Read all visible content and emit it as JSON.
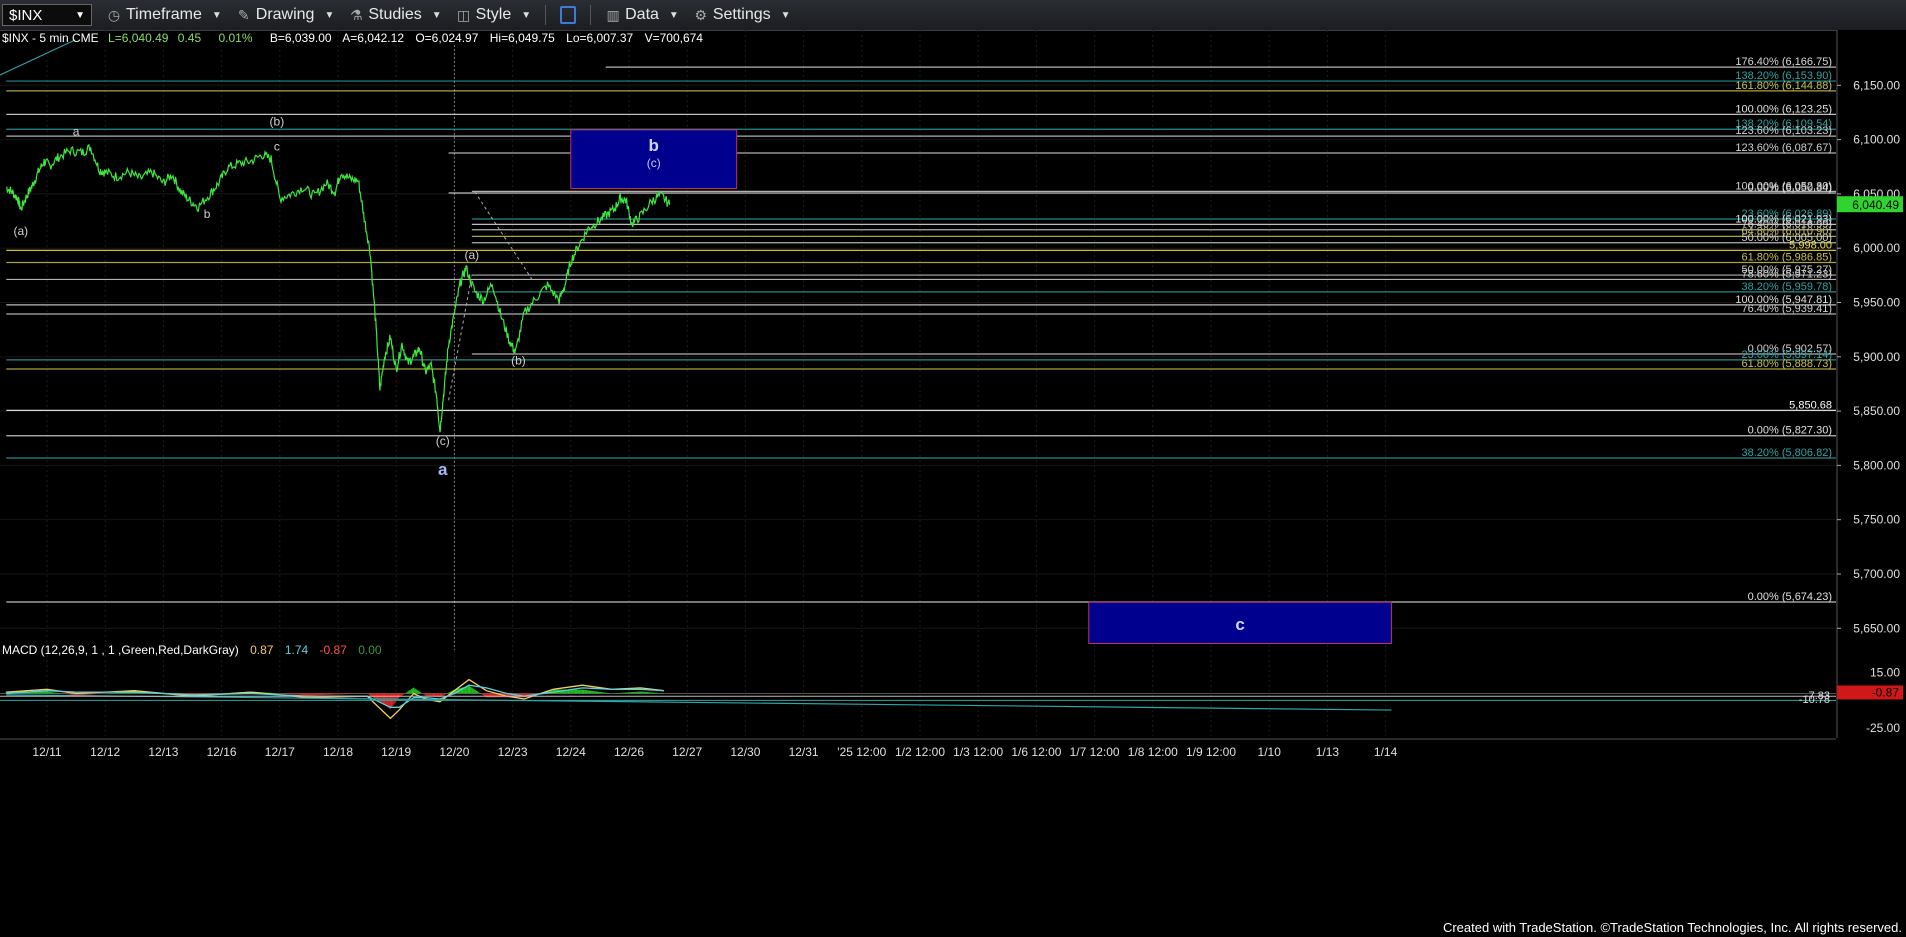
{
  "toolbar": {
    "symbol": "$INX",
    "timeframe": "Timeframe",
    "drawing": "Drawing",
    "studies": "Studies",
    "style": "Style",
    "data": "Data",
    "settings": "Settings"
  },
  "header": {
    "symbol_desc": "$INX - 5 min  CME",
    "last": "L=6,040.49",
    "change": "0.45",
    "pct": "0.01%",
    "bid": "B=6,039.00",
    "ask": "A=6,042.12",
    "open": "O=6,024.97",
    "high": "Hi=6,049.75",
    "low": "Lo=6,007.37",
    "volume": "V=700,674"
  },
  "macd": {
    "label": "MACD (12,26,9, 1 , 1 ,Green,Red,DarkGray)",
    "v1": "0.87",
    "v2": "1.74",
    "v3": "-0.87",
    "v4": "0.00",
    "v1_color": "#f0d060",
    "v2_color": "#5ad0e0",
    "v3_color": "#ff5050",
    "v4_color": "#3c9a3c"
  },
  "footer": "Created with TradeStation. ©TradeStation Technologies, Inc. All rights reserved.",
  "chart_data": {
    "type": "line",
    "y_axis": {
      "ticks": [
        6150,
        6100,
        6050,
        6000,
        5950,
        5900,
        5850,
        5800,
        5750,
        5700,
        5650
      ],
      "tick_labels": [
        "6,150.00",
        "6,100.00",
        "6,050.00",
        "6,000.00",
        "5,950.00",
        "5,900.00",
        "5,850.00",
        "5,800.00",
        "5,750.00",
        "5,700.00",
        "5,650.00"
      ],
      "ylim": [
        5630,
        6200
      ]
    },
    "x_axis": {
      "labels": [
        "12/11",
        "12/12",
        "12/13",
        "12/16",
        "12/17",
        "12/18",
        "12/19",
        "12/20",
        "12/23",
        "12/24",
        "12/26",
        "12/27",
        "12/30",
        "12/31",
        "'25 12:00",
        "1/2 12:00",
        "1/3 12:00",
        "1/6 12:00",
        "1/7 12:00",
        "1/8 12:00",
        "1/9 12:00",
        "1/10",
        "1/13",
        "1/14"
      ],
      "index": [
        0,
        1,
        2,
        3,
        4,
        5,
        6,
        7,
        8,
        9,
        10,
        11,
        12,
        13,
        14,
        15,
        16,
        17,
        18,
        19,
        20,
        21,
        22,
        23
      ]
    },
    "last_price": {
      "value": 6040.49,
      "label": "6,040.49"
    },
    "price_series": [
      [
        -0.7,
        6056
      ],
      [
        -0.6,
        6052
      ],
      [
        -0.5,
        6045
      ],
      [
        -0.45,
        6036
      ],
      [
        -0.35,
        6048
      ],
      [
        -0.25,
        6058
      ],
      [
        -0.15,
        6070
      ],
      [
        -0.05,
        6080
      ],
      [
        0.05,
        6076
      ],
      [
        0.2,
        6084
      ],
      [
        0.4,
        6090
      ],
      [
        0.6,
        6088
      ],
      [
        0.75,
        6093
      ],
      [
        0.9,
        6072
      ],
      [
        1.0,
        6070
      ],
      [
        1.2,
        6066
      ],
      [
        1.4,
        6070
      ],
      [
        1.6,
        6064
      ],
      [
        1.8,
        6070
      ],
      [
        2.0,
        6060
      ],
      [
        2.15,
        6068
      ],
      [
        2.3,
        6052
      ],
      [
        2.45,
        6044
      ],
      [
        2.6,
        6038
      ],
      [
        2.8,
        6050
      ],
      [
        2.95,
        6060
      ],
      [
        3.1,
        6074
      ],
      [
        3.3,
        6078
      ],
      [
        3.5,
        6080
      ],
      [
        3.7,
        6086
      ],
      [
        3.85,
        6082
      ],
      [
        4.0,
        6046
      ],
      [
        4.2,
        6050
      ],
      [
        4.4,
        6056
      ],
      [
        4.6,
        6048
      ],
      [
        4.8,
        6060
      ],
      [
        4.95,
        6052
      ],
      [
        5.05,
        6070
      ],
      [
        5.2,
        6064
      ],
      [
        5.35,
        6062
      ],
      [
        5.45,
        6028
      ],
      [
        5.55,
        5998
      ],
      [
        5.65,
        5930
      ],
      [
        5.72,
        5870
      ],
      [
        5.8,
        5900
      ],
      [
        5.9,
        5918
      ],
      [
        6.0,
        5888
      ],
      [
        6.1,
        5912
      ],
      [
        6.2,
        5894
      ],
      [
        6.3,
        5900
      ],
      [
        6.4,
        5908
      ],
      [
        6.5,
        5886
      ],
      [
        6.6,
        5892
      ],
      [
        6.7,
        5862
      ],
      [
        6.75,
        5832
      ],
      [
        6.82,
        5868
      ],
      [
        6.9,
        5912
      ],
      [
        7.0,
        5940
      ],
      [
        7.1,
        5968
      ],
      [
        7.2,
        5982
      ],
      [
        7.35,
        5960
      ],
      [
        7.5,
        5952
      ],
      [
        7.65,
        5968
      ],
      [
        7.8,
        5938
      ],
      [
        7.95,
        5914
      ],
      [
        8.05,
        5904
      ],
      [
        8.2,
        5940
      ],
      [
        8.4,
        5954
      ],
      [
        8.6,
        5966
      ],
      [
        8.8,
        5952
      ],
      [
        8.9,
        5966
      ],
      [
        9.0,
        5988
      ],
      [
        9.15,
        6004
      ],
      [
        9.3,
        6018
      ],
      [
        9.45,
        6024
      ],
      [
        9.6,
        6030
      ],
      [
        9.75,
        6036
      ],
      [
        9.85,
        6046
      ],
      [
        9.95,
        6044
      ],
      [
        10.05,
        6022
      ],
      [
        10.2,
        6030
      ],
      [
        10.4,
        6044
      ],
      [
        10.55,
        6049
      ],
      [
        10.7,
        6040
      ]
    ],
    "horizontal_levels": [
      {
        "value": 6166.75,
        "label": "176.40% (6,166.75)",
        "color": "#d8d8d8",
        "x_start": 9.6
      },
      {
        "value": 6153.9,
        "label": "138.20% (6,153.90)",
        "color": "#2fa4a4",
        "x_start": -0.7
      },
      {
        "value": 6144.88,
        "label": "161.80% (6,144.88)",
        "color": "#c8c050",
        "x_start": -0.7
      },
      {
        "value": 6123.25,
        "label": "100.00% (6,123.25)",
        "color": "#e0e0e0",
        "x_start": -0.7
      },
      {
        "value": 6109.54,
        "label": "138.20% (6,109.54)",
        "color": "#2fa4a4",
        "x_start": -0.7
      },
      {
        "value": 6103.23,
        "label": "123.60% (6,103.23)",
        "color": "#d0d0d0",
        "x_start": -0.7
      },
      {
        "value": 6087.67,
        "label": "123.60% (6,087.67)",
        "color": "#d0d0d0",
        "x_start": 6.9
      },
      {
        "value": 6052.3,
        "label": "100.00% (6,052.30)",
        "color": "#d0d0d0",
        "x_start": 7.3
      },
      {
        "value": 6050.84,
        "label": "0.00% (6,050.84)",
        "color": "#e0e0e0",
        "x_start": 6.9
      },
      {
        "value": 6026.89,
        "label": "23.60% (6,026.89)",
        "color": "#2fa4a4",
        "x_start": 7.3
      },
      {
        "value": 6021.93,
        "label": "100.00% (6,021.93)",
        "color": "#e0e0e0",
        "x_start": 7.3
      },
      {
        "value": 6016.99,
        "label": "76.40% (6,016.99)",
        "color": "#d0d0d0",
        "x_start": 7.3
      },
      {
        "value": 6010.9,
        "label": "64.80% (6,010.90)",
        "color": "#c8c050",
        "x_start": 7.3
      },
      {
        "value": 6005.0,
        "label": "50.00% (6,005.00)",
        "color": "#d0d0d0",
        "x_start": 7.3
      },
      {
        "value": 5998.0,
        "label": "5,998.00",
        "color": "#f0e040",
        "x_start": -0.7
      },
      {
        "value": 5986.85,
        "label": "61.80% (5,986.85)",
        "color": "#c8c050",
        "x_start": -0.7
      },
      {
        "value": 5975.27,
        "label": "50.00% (5,975.27)",
        "color": "#d0d0d0",
        "x_start": 7.3
      },
      {
        "value": 5971.23,
        "label": "78.60% (5,971.23)",
        "color": "#d0d0d0",
        "x_start": -0.7
      },
      {
        "value": 5959.78,
        "label": "38.20% (5,959.78)",
        "color": "#2fa4a4",
        "x_start": 7.3
      },
      {
        "value": 5947.81,
        "label": "100.00% (5,947.81)",
        "color": "#e0e0e0",
        "x_start": -0.7
      },
      {
        "value": 5939.41,
        "label": "76.40% (5,939.41)",
        "color": "#d0d0d0",
        "x_start": -0.7
      },
      {
        "value": 5902.57,
        "label": "0.00% (5,902.57)",
        "color": "#d0d0d0",
        "x_start": 7.3
      },
      {
        "value": 5897.14,
        "label": "23.60% (5,897.14)",
        "color": "#2fa4a4",
        "x_start": -0.7
      },
      {
        "value": 5888.73,
        "label": "61.80% (5,888.73)",
        "color": "#c8c050",
        "x_start": -0.7
      },
      {
        "value": 5850.68,
        "label": "5,850.68",
        "color": "#ffffff",
        "x_start": -0.7
      },
      {
        "value": 5827.3,
        "label": "0.00% (5,827.30)",
        "color": "#e0e0e0",
        "x_start": -0.7
      },
      {
        "value": 5806.82,
        "label": "38.20% (5,806.82)",
        "color": "#2fa4a4",
        "x_start": -0.7
      },
      {
        "value": 5674.23,
        "label": "0.00% (5,674.23)",
        "color": "#e0e0e0",
        "x_start": -0.7
      }
    ],
    "target_boxes": [
      {
        "x0": 9.0,
        "x1": 11.85,
        "y0": 6055,
        "y1": 6109,
        "label": "b",
        "sublabel": "(c)"
      },
      {
        "x0": 17.9,
        "x1": 23.1,
        "y0": 5636,
        "y1": 5674,
        "label": "c",
        "sublabel": ""
      }
    ],
    "wave_labels": [
      {
        "x": 0.5,
        "y": 6104,
        "text": "a"
      },
      {
        "x": -0.45,
        "y": 6012,
        "text": "(a)"
      },
      {
        "x": 2.75,
        "y": 6028,
        "text": "b"
      },
      {
        "x": 3.95,
        "y": 6113,
        "text": "(b)"
      },
      {
        "x": 3.95,
        "y": 6090,
        "text": "c"
      },
      {
        "x": 7.3,
        "y": 5990,
        "text": "(a)"
      },
      {
        "x": 8.1,
        "y": 5893,
        "text": "(b)"
      },
      {
        "x": 6.8,
        "y": 5819,
        "text": "(c)"
      },
      {
        "x": 6.8,
        "y": 5791,
        "text": "a",
        "size": "large"
      }
    ],
    "macd": {
      "ylim": [
        -30,
        22
      ],
      "ticks": [
        15,
        0,
        -25
      ],
      "tick_labels": [
        "15.00",
        "0.00",
        "-25.00"
      ],
      "right_labels": [
        {
          "value": -1.0,
          "label": "-7.83"
        },
        {
          "value": -4.0,
          "label": "-10.78"
        }
      ],
      "macd_line": [
        [
          -0.7,
          1
        ],
        [
          0,
          3
        ],
        [
          0.5,
          0
        ],
        [
          1.5,
          2
        ],
        [
          2.5,
          -2
        ],
        [
          3.5,
          1
        ],
        [
          4.5,
          -3
        ],
        [
          5.5,
          -2
        ],
        [
          5.9,
          -18
        ],
        [
          6.05,
          -12
        ],
        [
          6.3,
          0
        ],
        [
          6.5,
          -4
        ],
        [
          6.75,
          -6
        ],
        [
          7.0,
          2
        ],
        [
          7.25,
          10
        ],
        [
          7.55,
          2
        ],
        [
          7.9,
          -2
        ],
        [
          8.2,
          -4
        ],
        [
          8.7,
          3
        ],
        [
          9.2,
          6
        ],
        [
          9.7,
          3
        ],
        [
          10.2,
          4
        ],
        [
          10.6,
          2
        ]
      ],
      "signal_line": [
        [
          -0.7,
          0
        ],
        [
          0,
          2
        ],
        [
          0.5,
          1
        ],
        [
          1.5,
          1
        ],
        [
          2.5,
          -1
        ],
        [
          3.5,
          0
        ],
        [
          4.5,
          -2
        ],
        [
          5.5,
          -2
        ],
        [
          5.9,
          -10
        ],
        [
          6.05,
          -10
        ],
        [
          6.3,
          -3
        ],
        [
          6.5,
          -3
        ],
        [
          6.75,
          -4
        ],
        [
          7.0,
          0
        ],
        [
          7.25,
          6
        ],
        [
          7.55,
          4
        ],
        [
          7.9,
          0
        ],
        [
          8.2,
          -2
        ],
        [
          8.7,
          1
        ],
        [
          9.2,
          4
        ],
        [
          9.7,
          3
        ],
        [
          10.2,
          3
        ],
        [
          10.6,
          2
        ]
      ],
      "trend_line": [
        [
          -0.7,
          -1
        ],
        [
          23.1,
          -12
        ]
      ]
    }
  }
}
